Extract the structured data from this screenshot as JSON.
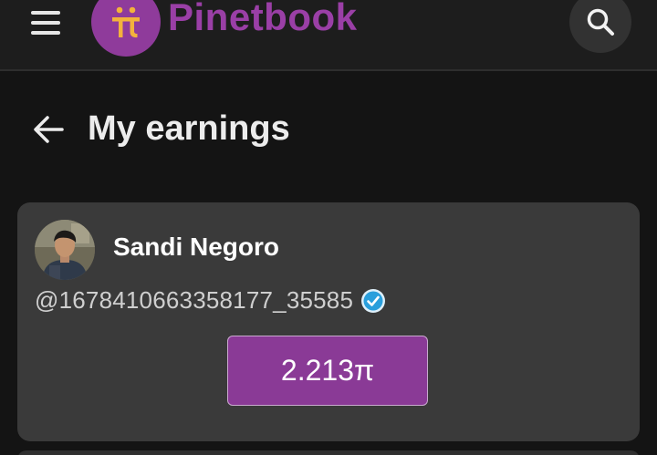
{
  "header": {
    "brand": "Pinetbook",
    "logo_glyph": "π",
    "menu_icon": "hamburger-menu-icon",
    "search_icon": "search-icon",
    "brand_color": "#9a3fa6",
    "logo_badge_color": "#f3b23c"
  },
  "page": {
    "title": "My earnings",
    "back_icon": "arrow-left-icon"
  },
  "profile": {
    "name": "Sandi Negoro",
    "handle": "@1678410663358177_35585",
    "verified": true,
    "verified_icon": "verified-check-icon",
    "verified_color": "#2a9fdc"
  },
  "earnings": {
    "amount": "2.213π",
    "button_color": "#8a3a96"
  }
}
